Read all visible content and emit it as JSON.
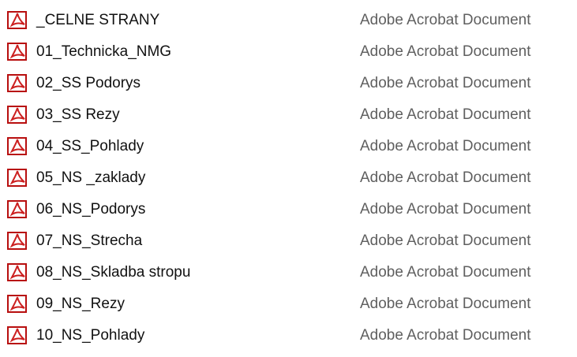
{
  "files": [
    {
      "name": "_CELNE STRANY",
      "type": "Adobe Acrobat Document",
      "icon": "pdf-file-icon"
    },
    {
      "name": "01_Technicka_NMG",
      "type": "Adobe Acrobat Document",
      "icon": "pdf-file-icon"
    },
    {
      "name": "02_SS Podorys",
      "type": "Adobe Acrobat Document",
      "icon": "pdf-file-icon"
    },
    {
      "name": "03_SS Rezy",
      "type": "Adobe Acrobat Document",
      "icon": "pdf-file-icon"
    },
    {
      "name": "04_SS_Pohlady",
      "type": "Adobe Acrobat Document",
      "icon": "pdf-file-icon"
    },
    {
      "name": "05_NS _zaklady",
      "type": "Adobe Acrobat Document",
      "icon": "pdf-file-icon"
    },
    {
      "name": "06_NS_Podorys",
      "type": "Adobe Acrobat Document",
      "icon": "pdf-file-icon"
    },
    {
      "name": "07_NS_Strecha",
      "type": "Adobe Acrobat Document",
      "icon": "pdf-file-icon"
    },
    {
      "name": "08_NS_Skladba stropu",
      "type": "Adobe Acrobat Document",
      "icon": "pdf-file-icon"
    },
    {
      "name": "09_NS_Rezy",
      "type": "Adobe Acrobat Document",
      "icon": "pdf-file-icon"
    },
    {
      "name": "10_NS_Pohlady",
      "type": "Adobe Acrobat Document",
      "icon": "pdf-file-icon"
    }
  ],
  "colors": {
    "pdf_icon_red": "#cc1f1f",
    "type_text": "#5f5f5f"
  }
}
